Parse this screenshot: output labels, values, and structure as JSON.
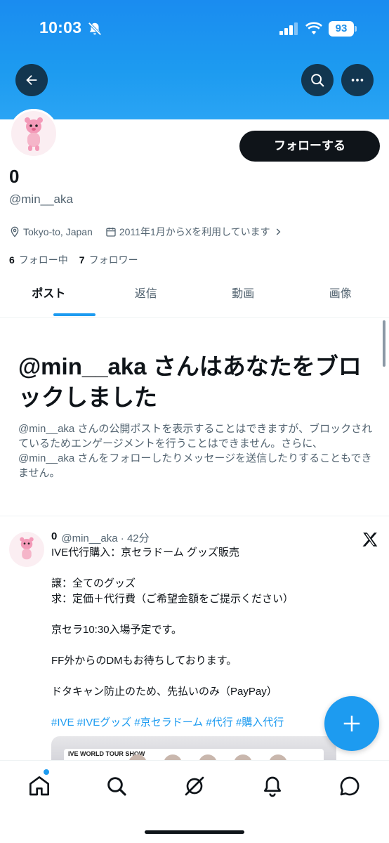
{
  "status_bar": {
    "time": "10:03",
    "battery": "93"
  },
  "profile": {
    "name": "0",
    "handle": "@min__aka",
    "location": "Tokyo-to, Japan",
    "joined": "2011年1月からXを利用しています",
    "following_count": "6",
    "following_label": "フォロー中",
    "followers_count": "7",
    "followers_label": "フォロワー",
    "follow_button": "フォローする"
  },
  "tabs": [
    {
      "label": "ポスト",
      "active": true
    },
    {
      "label": "返信"
    },
    {
      "label": "動画"
    },
    {
      "label": "画像"
    }
  ],
  "blocked": {
    "title": "@min__aka さんはあなたをブロックしました",
    "description": "@min__aka さんの公開ポストを表示することはできますが、ブロックされているためエンゲージメントを行うことはできません。さらに、@min__aka さんをフォローしたりメッセージを送信したりすることもできません。"
  },
  "post": {
    "author": "0",
    "meta": "@min__aka · 42分",
    "lines": [
      "IVE代行購入：京セラドーム グッズ販売",
      "",
      "譲：全てのグッズ",
      "求：定価＋代行費（ご希望金額をご提示ください）",
      "",
      "京セラ10:30入場予定です。",
      "",
      "FF外からのDMもお待ちしております。",
      "",
      "ドタキャン防止のため、先払いのみ（PayPay）",
      ""
    ],
    "hashtags": "#IVE #IVEグッズ #京セラドーム #代行 #購入代行",
    "image_text": "IVE WORLD TOUR SHOW"
  },
  "icons": {
    "back": "back-arrow-icon",
    "search": "search-icon",
    "more": "more-icon",
    "location": "location-pin-icon",
    "calendar": "calendar-icon",
    "compose": "plus-icon",
    "nav": [
      "home-icon",
      "search-icon",
      "grok-icon",
      "bell-icon",
      "message-icon"
    ]
  },
  "colors": {
    "accent": "#1d9bf0",
    "text": "#0f1419",
    "muted": "#536471"
  }
}
